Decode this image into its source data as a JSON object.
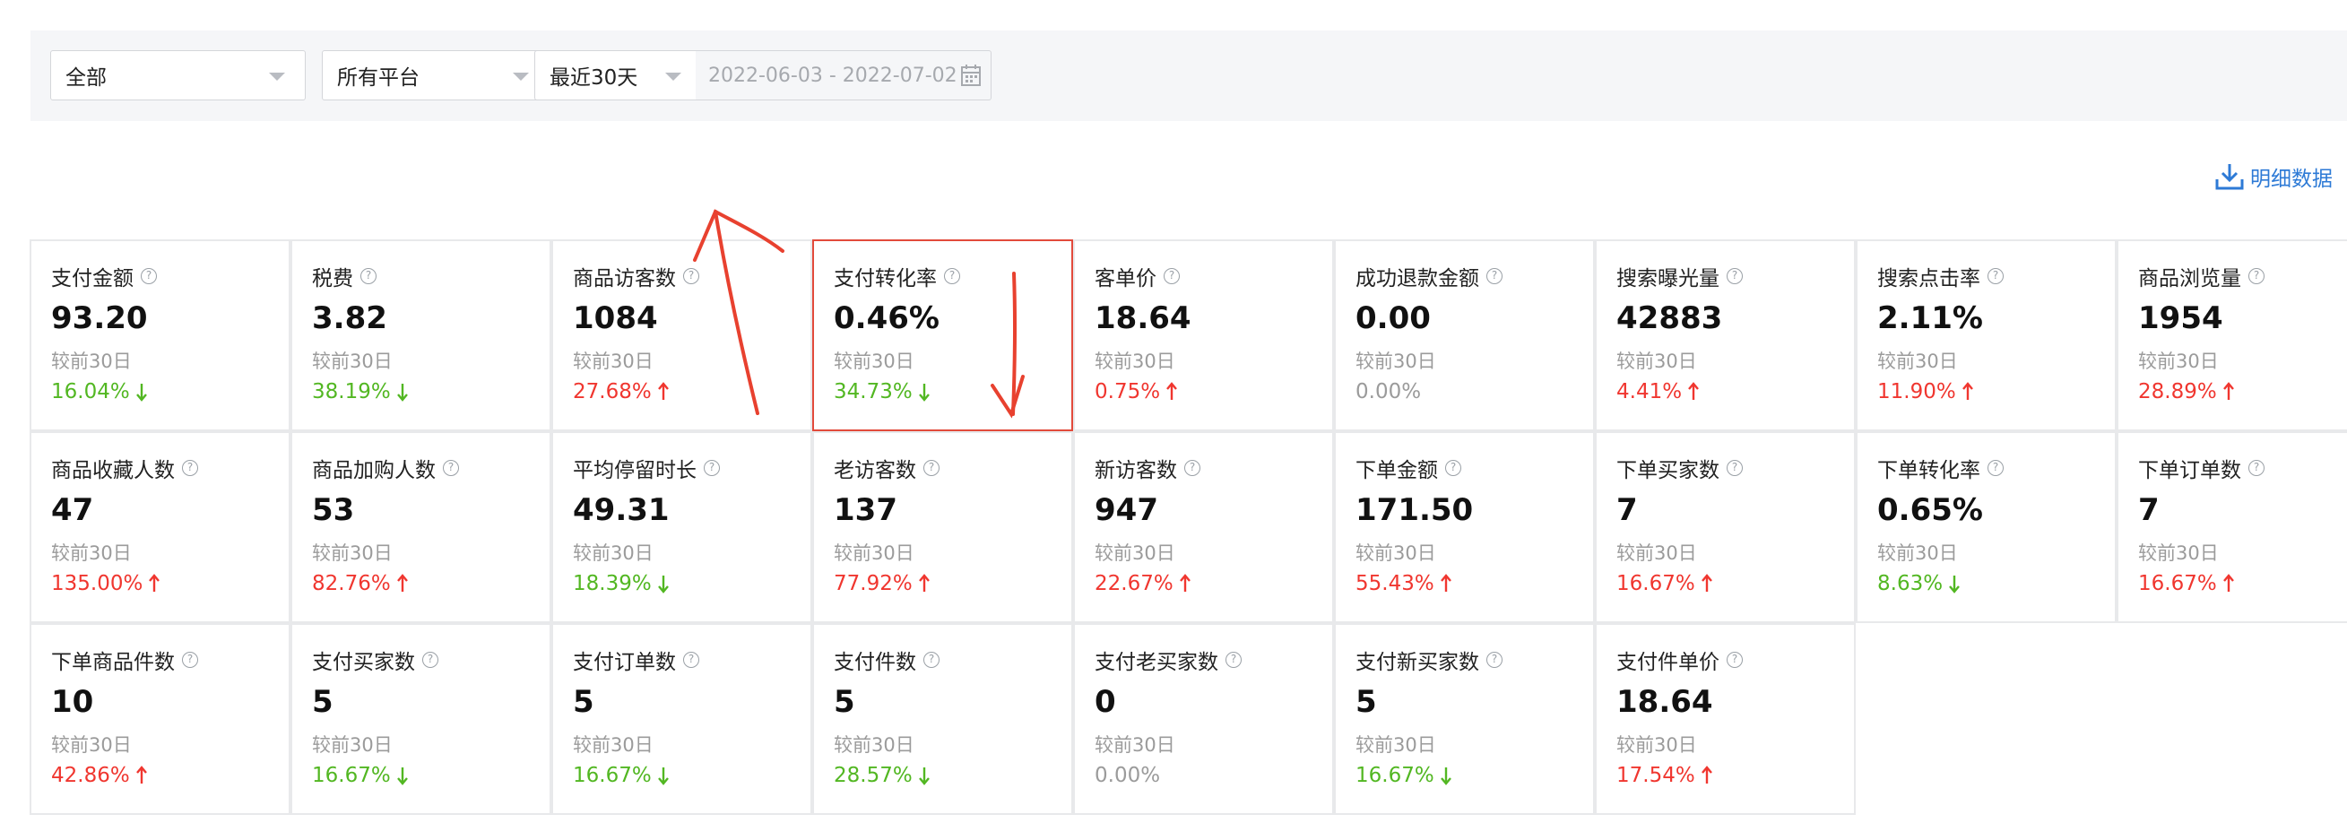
{
  "filters": {
    "category": "全部",
    "platform": "所有平台",
    "period": "最近30天",
    "date_range": "2022-06-03 - 2022-07-02"
  },
  "download_label": "明细数据",
  "compare_label": "较前30日",
  "metrics": [
    {
      "name": "支付金额",
      "value": "93.20",
      "change": "16.04%",
      "trend": "down"
    },
    {
      "name": "税费",
      "value": "3.82",
      "change": "38.19%",
      "trend": "down"
    },
    {
      "name": "商品访客数",
      "value": "1084",
      "change": "27.68%",
      "trend": "up"
    },
    {
      "name": "支付转化率",
      "value": "0.46%",
      "change": "34.73%",
      "trend": "down"
    },
    {
      "name": "客单价",
      "value": "18.64",
      "change": "0.75%",
      "trend": "up"
    },
    {
      "name": "成功退款金额",
      "value": "0.00",
      "change": "0.00%",
      "trend": "flat"
    },
    {
      "name": "搜索曝光量",
      "value": "42883",
      "change": "4.41%",
      "trend": "up"
    },
    {
      "name": "搜索点击率",
      "value": "2.11%",
      "change": "11.90%",
      "trend": "up"
    },
    {
      "name": "商品浏览量",
      "value": "1954",
      "change": "28.89%",
      "trend": "up"
    },
    {
      "name": "商品收藏人数",
      "value": "47",
      "change": "135.00%",
      "trend": "up"
    },
    {
      "name": "商品加购人数",
      "value": "53",
      "change": "82.76%",
      "trend": "up"
    },
    {
      "name": "平均停留时长",
      "value": "49.31",
      "change": "18.39%",
      "trend": "down"
    },
    {
      "name": "老访客数",
      "value": "137",
      "change": "77.92%",
      "trend": "up"
    },
    {
      "name": "新访客数",
      "value": "947",
      "change": "22.67%",
      "trend": "up"
    },
    {
      "name": "下单金额",
      "value": "171.50",
      "change": "55.43%",
      "trend": "up"
    },
    {
      "name": "下单买家数",
      "value": "7",
      "change": "16.67%",
      "trend": "up"
    },
    {
      "name": "下单转化率",
      "value": "0.65%",
      "change": "8.63%",
      "trend": "down"
    },
    {
      "name": "下单订单数",
      "value": "7",
      "change": "16.67%",
      "trend": "up"
    },
    {
      "name": "下单商品件数",
      "value": "10",
      "change": "42.86%",
      "trend": "up"
    },
    {
      "name": "支付买家数",
      "value": "5",
      "change": "16.67%",
      "trend": "down"
    },
    {
      "name": "支付订单数",
      "value": "5",
      "change": "16.67%",
      "trend": "down"
    },
    {
      "name": "支付件数",
      "value": "5",
      "change": "28.57%",
      "trend": "down"
    },
    {
      "name": "支付老买家数",
      "value": "0",
      "change": "0.00%",
      "trend": "flat"
    },
    {
      "name": "支付新买家数",
      "value": "5",
      "change": "16.67%",
      "trend": "down"
    },
    {
      "name": "支付件单价",
      "value": "18.64",
      "change": "17.54%",
      "trend": "up"
    }
  ],
  "selected_metric": "支付转化率",
  "colors": {
    "up": "#f0362f",
    "down": "#52b722",
    "flat": "#9b9b9b",
    "link": "#2d7ad6",
    "highlight": "#e24a3b"
  }
}
